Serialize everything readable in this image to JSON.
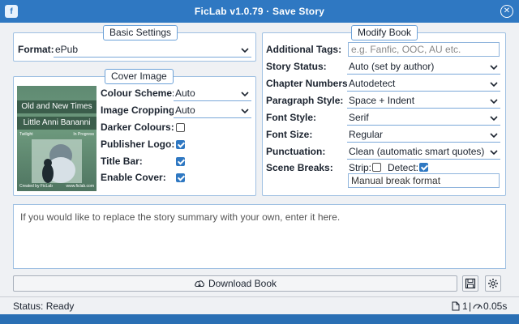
{
  "window": {
    "title": "FicLab v1.0.79 · Save Story"
  },
  "basic_settings": {
    "legend": "Basic Settings",
    "format_label": "Format:",
    "format_value": "ePub"
  },
  "cover_image": {
    "legend": "Cover Image",
    "cover_title": "Old and New Times",
    "cover_author": "Little Anni Bananni",
    "cover_small_left": "Twilight",
    "cover_small_right": "In Progress",
    "cover_footer_left": "Created by FicLab",
    "cover_footer_right": "www.ficlab.com",
    "colour_scheme_label": "Colour Scheme:",
    "colour_scheme_value": "Auto",
    "image_cropping_label": "Image Cropping:",
    "image_cropping_value": "Auto",
    "darker_colours_label": "Darker Colours:",
    "darker_colours_checked": false,
    "publisher_logo_label": "Publisher Logo:",
    "publisher_logo_checked": true,
    "title_bar_label": "Title Bar:",
    "title_bar_checked": true,
    "enable_cover_label": "Enable Cover:",
    "enable_cover_checked": true
  },
  "modify_book": {
    "legend": "Modify Book",
    "additional_tags_label": "Additional Tags:",
    "additional_tags_placeholder": "e.g. Fanfic, OOC, AU etc.",
    "story_status_label": "Story Status:",
    "story_status_value": "Auto (set by author)",
    "chapter_numbers_label": "Chapter Numbers:",
    "chapter_numbers_value": "Autodetect",
    "paragraph_style_label": "Paragraph Style:",
    "paragraph_style_value": "Space + Indent",
    "font_style_label": "Font Style:",
    "font_style_value": "Serif",
    "font_size_label": "Font Size:",
    "font_size_value": "Regular",
    "punctuation_label": "Punctuation:",
    "punctuation_value": "Clean (automatic smart quotes)",
    "scene_breaks_label": "Scene Breaks:",
    "strip_label": "Strip:",
    "strip_checked": false,
    "detect_label": "Detect:",
    "detect_checked": true,
    "manual_break_value": "Manual break format"
  },
  "summary": {
    "placeholder": "If you would like to replace the story summary with your own, enter it here."
  },
  "actions": {
    "download_label": "Download Book"
  },
  "status": {
    "text": "Status: Ready",
    "count": "1",
    "time": "0.05s"
  }
}
